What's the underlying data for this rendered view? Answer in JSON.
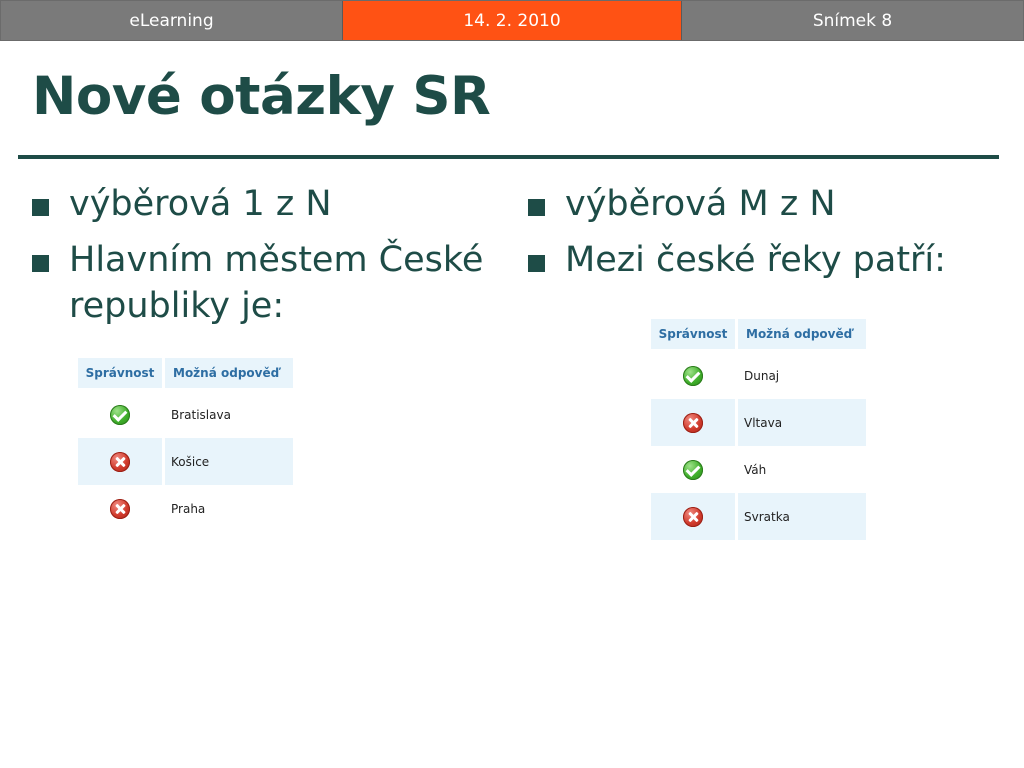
{
  "header": {
    "left": "eLearning",
    "center": "14. 2. 2010",
    "right": "Snímek 8"
  },
  "title": "Nové otázky SR",
  "colors": {
    "accent": "#1e4c47",
    "date_highlight": "#ff5214",
    "header_gray": "#7a7a7a",
    "table_header_bg": "#e8f4fb",
    "table_header_text": "#2e6ea3"
  },
  "left_column": {
    "bullets": [
      "výběrová 1 z N",
      "Hlavním městem České republiky je:"
    ],
    "table": {
      "headers": [
        "Správnost",
        "Možná odpověď"
      ],
      "rows": [
        {
          "icon": "check-icon",
          "answer": "Bratislava"
        },
        {
          "icon": "cross-icon",
          "answer": "Košice"
        },
        {
          "icon": "cross-icon",
          "answer": "Praha"
        }
      ]
    }
  },
  "right_column": {
    "bullets": [
      "výběrová M z N",
      "Mezi české řeky patří:"
    ],
    "table": {
      "headers": [
        "Správnost",
        "Možná odpověď"
      ],
      "rows": [
        {
          "icon": "check-icon",
          "answer": "Dunaj"
        },
        {
          "icon": "cross-icon",
          "answer": "Vltava"
        },
        {
          "icon": "check-icon",
          "answer": "Váh"
        },
        {
          "icon": "cross-icon",
          "answer": "Svratka"
        }
      ]
    }
  }
}
